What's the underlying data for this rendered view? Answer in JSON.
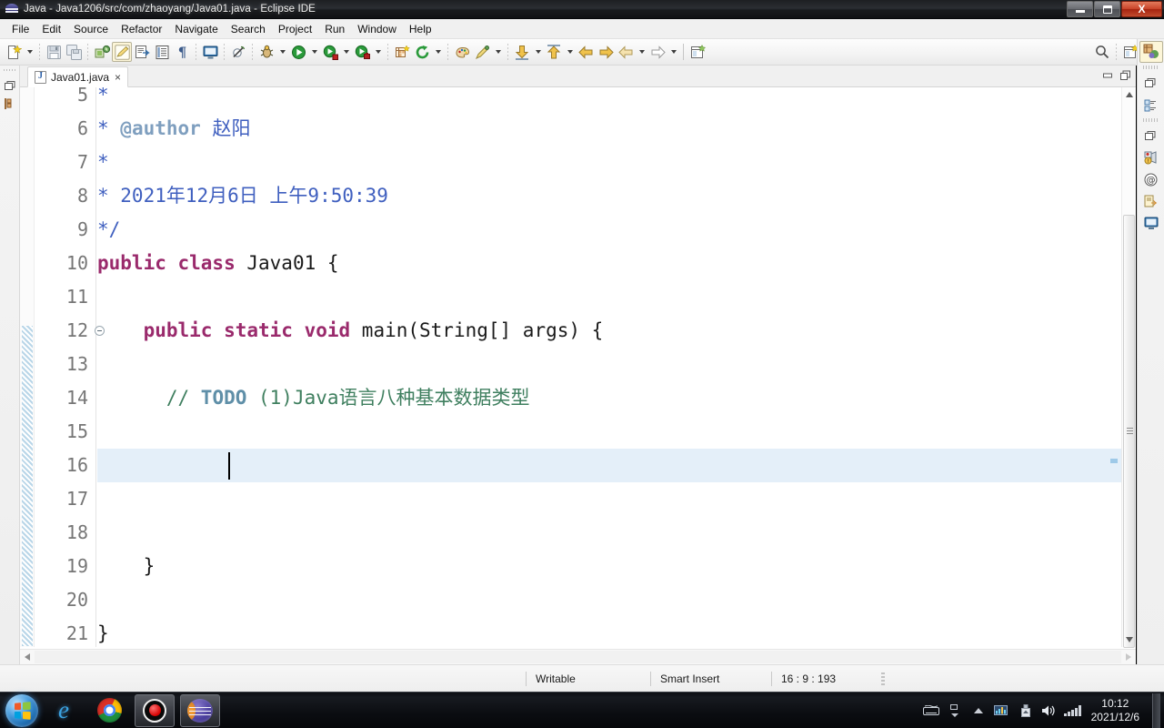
{
  "window": {
    "title": "Java - Java1206/src/com/zhaoyang/Java01.java - Eclipse IDE",
    "app_icon": "eclipse-icon",
    "minimize_label": "Minimize",
    "restore_label": "Restore",
    "close_label": "X"
  },
  "menubar": {
    "items": [
      {
        "label": "File"
      },
      {
        "label": "Edit"
      },
      {
        "label": "Source"
      },
      {
        "label": "Refactor"
      },
      {
        "label": "Navigate"
      },
      {
        "label": "Search"
      },
      {
        "label": "Project"
      },
      {
        "label": "Run"
      },
      {
        "label": "Window"
      },
      {
        "label": "Help"
      }
    ]
  },
  "toolbar": {
    "items": [
      {
        "name": "new-wizard-icon",
        "glyph": "new"
      },
      {
        "name": "new-wizard-dropdown-icon",
        "glyph": "caret"
      },
      {
        "name": "separator",
        "glyph": "sep"
      },
      {
        "name": "save-icon",
        "glyph": "save"
      },
      {
        "name": "save-all-icon",
        "glyph": "saveall"
      },
      {
        "name": "separator",
        "glyph": "sep"
      },
      {
        "name": "new-java-package-icon",
        "glyph": "package"
      },
      {
        "name": "toggle-mark-occurrences-icon",
        "glyph": "pencil",
        "selected": true
      },
      {
        "name": "open-type-icon",
        "glyph": "opentype"
      },
      {
        "name": "open-task-icon",
        "glyph": "tasklist"
      },
      {
        "name": "show-whitespace-icon",
        "glyph": "pilcrow"
      },
      {
        "name": "separator",
        "glyph": "sep"
      },
      {
        "name": "console-icon",
        "glyph": "console"
      },
      {
        "name": "separator",
        "glyph": "sep"
      },
      {
        "name": "skip-breakpoints-icon",
        "glyph": "skipbp"
      },
      {
        "name": "separator",
        "glyph": "sep"
      },
      {
        "name": "debug-icon",
        "glyph": "bug"
      },
      {
        "name": "debug-dropdown-icon",
        "glyph": "caret"
      },
      {
        "name": "run-icon",
        "glyph": "run"
      },
      {
        "name": "run-dropdown-icon",
        "glyph": "caret"
      },
      {
        "name": "run-external-tools-icon",
        "glyph": "runext"
      },
      {
        "name": "run-external-tools-dropdown-icon",
        "glyph": "caret"
      },
      {
        "name": "coverage-icon",
        "glyph": "coverage"
      },
      {
        "name": "coverage-dropdown-icon",
        "glyph": "caret"
      },
      {
        "name": "separator",
        "glyph": "sep"
      },
      {
        "name": "new-java-project-icon",
        "glyph": "newproj"
      },
      {
        "name": "refresh-icon",
        "glyph": "refresh"
      },
      {
        "name": "refresh-dropdown-icon",
        "glyph": "caret"
      },
      {
        "name": "separator",
        "glyph": "sep"
      },
      {
        "name": "search-palette-icon",
        "glyph": "palette"
      },
      {
        "name": "annotation-icon",
        "glyph": "pen"
      },
      {
        "name": "annotation-dropdown-icon",
        "glyph": "caret"
      },
      {
        "name": "separator",
        "glyph": "sep"
      },
      {
        "name": "next-annotation-icon",
        "glyph": "downarr"
      },
      {
        "name": "next-annotation-dropdown-icon",
        "glyph": "caret"
      },
      {
        "name": "previous-annotation-icon",
        "glyph": "uparr"
      },
      {
        "name": "previous-annotation-dropdown-icon",
        "glyph": "caret"
      },
      {
        "name": "back-icon",
        "glyph": "back"
      },
      {
        "name": "forward-icon",
        "glyph": "forward"
      },
      {
        "name": "previous-edit-icon",
        "glyph": "prevedit"
      },
      {
        "name": "previous-edit-dropdown-icon",
        "glyph": "caret"
      },
      {
        "name": "next-edit-icon",
        "glyph": "nextedit"
      },
      {
        "name": "next-edit-dropdown-icon",
        "glyph": "caret"
      },
      {
        "name": "separator",
        "glyph": "solidsep"
      },
      {
        "name": "open-perspective-icon",
        "glyph": "openpersp"
      }
    ],
    "right_items": [
      {
        "name": "quick-access-search-icon",
        "glyph": "search"
      },
      {
        "name": "separator",
        "glyph": "sep"
      },
      {
        "name": "open-perspective-button",
        "glyph": "openpersp2"
      },
      {
        "name": "java-perspective-button",
        "glyph": "javapersp",
        "selected": true
      }
    ]
  },
  "left_strip": {
    "items": [
      {
        "name": "restore-view-icon",
        "glyph": "restore"
      },
      {
        "name": "package-explorer-icon",
        "glyph": "package"
      }
    ]
  },
  "right_strip": {
    "items": [
      {
        "name": "java-perspective-icon",
        "glyph": "javapersp",
        "selected": true
      },
      {
        "name": "restore-view-icon",
        "glyph": "restore"
      },
      {
        "name": "outline-view-icon",
        "glyph": "outline"
      },
      {
        "name": "minimize-view-icon",
        "glyph": "restore"
      },
      {
        "name": "problems-view-icon",
        "glyph": "problems"
      },
      {
        "name": "javadoc-view-icon",
        "glyph": "at"
      },
      {
        "name": "declaration-view-icon",
        "glyph": "declaration"
      },
      {
        "name": "console-view-icon",
        "glyph": "console"
      }
    ]
  },
  "editor": {
    "tab": {
      "label": "Java01.java",
      "close_label": "×",
      "file_icon": "java-file-icon"
    },
    "part_buttons": [
      {
        "name": "minimize-editor-button",
        "glyph": "min"
      },
      {
        "name": "maximize-editor-button",
        "glyph": "max"
      }
    ],
    "first_line_number": 5,
    "lines": [
      {
        "num": 5,
        "indent": 1,
        "segments": [
          {
            "cls": "c-jdoc",
            "text": "*"
          }
        ]
      },
      {
        "num": 6,
        "indent": 1,
        "segments": [
          {
            "cls": "c-jdoc",
            "text": "* "
          },
          {
            "cls": "c-tag",
            "text": "@author"
          },
          {
            "cls": "c-jdoc",
            "text": " 赵阳"
          }
        ]
      },
      {
        "num": 7,
        "indent": 1,
        "segments": [
          {
            "cls": "c-jdoc",
            "text": "*"
          }
        ]
      },
      {
        "num": 8,
        "indent": 1,
        "segments": [
          {
            "cls": "c-jdoc",
            "text": "* 2021年12月6日 上午9:50:39"
          }
        ]
      },
      {
        "num": 9,
        "indent": 1,
        "segments": [
          {
            "cls": "c-jdoc",
            "text": "*/"
          }
        ]
      },
      {
        "num": 10,
        "indent": 0,
        "segments": [
          {
            "cls": "c-kw",
            "text": "public class "
          },
          {
            "cls": "c-plain",
            "text": "Java01 {"
          }
        ]
      },
      {
        "num": 11,
        "indent": 0,
        "segments": []
      },
      {
        "num": 12,
        "indent": 0,
        "fold": true,
        "segments": [
          {
            "cls": "c-plain",
            "text": "    "
          },
          {
            "cls": "c-kw",
            "text": "public static void "
          },
          {
            "cls": "c-plain",
            "text": "main(String[] args) {"
          }
        ]
      },
      {
        "num": 13,
        "indent": 0,
        "segments": []
      },
      {
        "num": 14,
        "indent": 0,
        "segments": [
          {
            "cls": "c-plain",
            "text": "      "
          },
          {
            "cls": "c-cmt",
            "text": "// "
          },
          {
            "cls": "c-todo",
            "text": "TODO"
          },
          {
            "cls": "c-cmt",
            "text": " (1)Java语言八种基本数据类型"
          }
        ]
      },
      {
        "num": 15,
        "indent": 0,
        "segments": []
      },
      {
        "num": 16,
        "indent": 0,
        "current": true,
        "caret": true,
        "segments": []
      },
      {
        "num": 17,
        "indent": 0,
        "segments": []
      },
      {
        "num": 18,
        "indent": 0,
        "segments": []
      },
      {
        "num": 19,
        "indent": 0,
        "segments": [
          {
            "cls": "c-plain",
            "text": "    }"
          }
        ]
      },
      {
        "num": 20,
        "indent": 0,
        "segments": []
      },
      {
        "num": 21,
        "indent": 0,
        "segments": [
          {
            "cls": "c-plain",
            "text": "}"
          }
        ]
      }
    ]
  },
  "statusbar": {
    "writable": "Writable",
    "insert_mode": "Smart Insert",
    "position": "16 : 9 : 193"
  },
  "taskbar": {
    "start_label": "Start",
    "apps": [
      {
        "name": "taskbar-internet-explorer",
        "glyph": "ie",
        "active": false
      },
      {
        "name": "taskbar-google-chrome",
        "glyph": "chrome",
        "active": false
      },
      {
        "name": "taskbar-screen-recorder",
        "glyph": "recorder",
        "active": true
      },
      {
        "name": "taskbar-eclipse",
        "glyph": "eclipse",
        "active": true
      }
    ],
    "tray": [
      {
        "name": "tray-keyboard-icon",
        "glyph": "keyboard"
      },
      {
        "name": "tray-overflow-icon",
        "glyph": "overflow"
      },
      {
        "name": "tray-show-hidden-icon",
        "glyph": "chevron-up"
      },
      {
        "name": "tray-network-monitor-icon",
        "glyph": "netmon"
      },
      {
        "name": "tray-safely-remove-icon",
        "glyph": "eject"
      },
      {
        "name": "tray-volume-icon",
        "glyph": "volume"
      },
      {
        "name": "tray-signal-icon",
        "glyph": "signal"
      }
    ],
    "clock_time": "10:12",
    "clock_date": "2021/12/6"
  },
  "colors": {
    "keyword": "#9a2a6c",
    "comment": "#3f7f5f",
    "javadoc": "#3f5fbf",
    "javadoc_tag": "#7f9fbf",
    "todo": "#5f8fa8",
    "current_line": "#e4eff9",
    "titlebar_close": "#c9452a"
  }
}
